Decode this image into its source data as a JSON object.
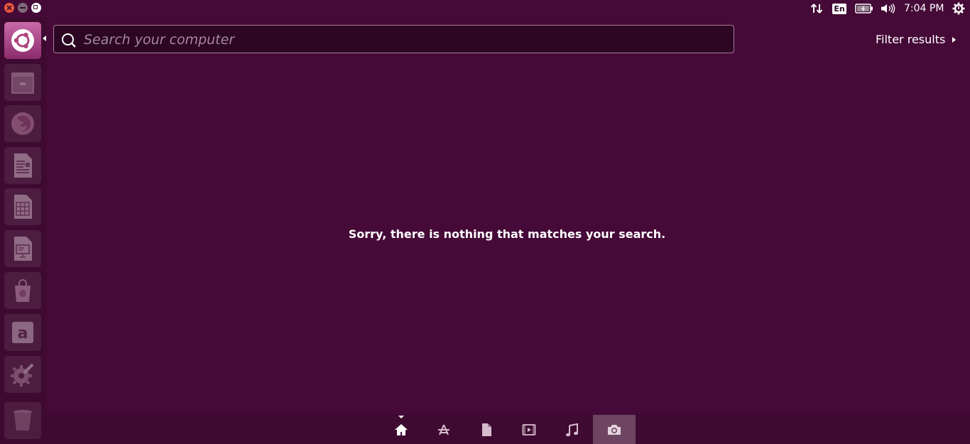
{
  "top_panel": {
    "language": "En",
    "clock": "7:04 PM",
    "window_buttons": [
      "close",
      "minimize",
      "maximize"
    ],
    "indicators": [
      "network-icon",
      "keyboard-language-icon",
      "battery-icon",
      "volume-icon",
      "system-gear-icon"
    ]
  },
  "launcher": {
    "items": [
      "dash-home",
      "files",
      "firefox",
      "libreoffice-writer",
      "libreoffice-calc",
      "libreoffice-impress",
      "ubuntu-software-center",
      "amazon",
      "system-settings",
      "trash"
    ]
  },
  "search": {
    "placeholder": "Search your computer",
    "value": ""
  },
  "filter": {
    "label": "Filter results"
  },
  "message": "Sorry, there is nothing that matches your search.",
  "lenses": {
    "items": [
      "home",
      "applications",
      "files",
      "video",
      "music",
      "photos"
    ],
    "active": "home",
    "hovered": "photos"
  },
  "colors": {
    "background": "#450a37",
    "launcher": "#3e0a31",
    "search_border": "#a67d99"
  }
}
